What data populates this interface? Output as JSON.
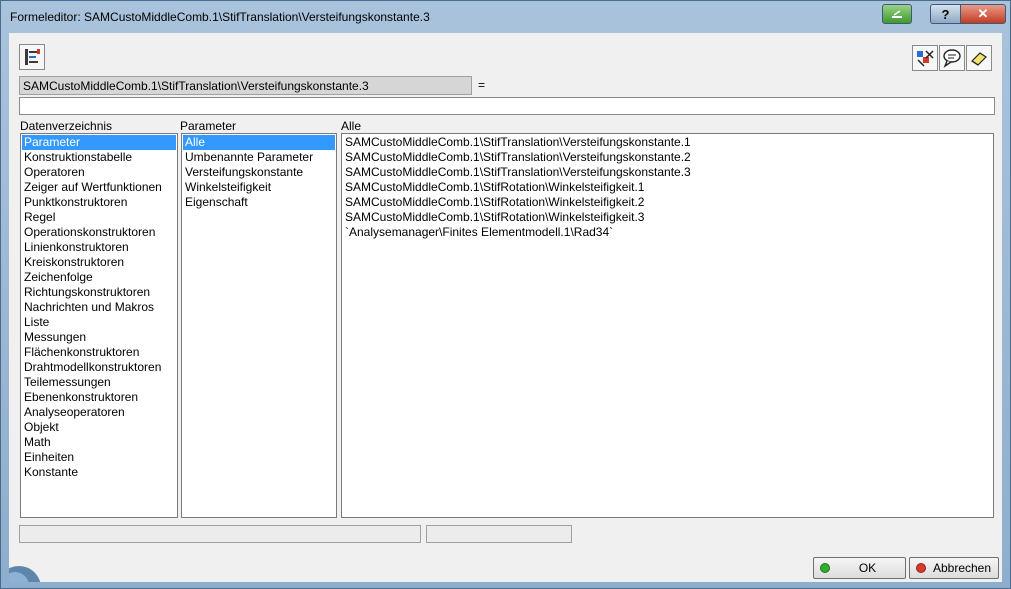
{
  "window": {
    "title": "Formeleditor: SAMCustoMiddleComb.1\\StifTranslation\\Versteifungskonstante.3"
  },
  "formula": {
    "parameter_path": "SAMCustoMiddleComb.1\\StifTranslation\\Versteifungskonstante.3",
    "equals": "=",
    "value": ""
  },
  "columns": {
    "dictionary": {
      "header": "Datenverzeichnis",
      "selected_index": 0,
      "items": [
        "Parameter",
        "Konstruktionstabelle",
        "Operatoren",
        "Zeiger auf Wertfunktionen",
        "Punktkonstruktoren",
        "Regel",
        "Operationskonstruktoren",
        "Linienkonstruktoren",
        "Kreiskonstruktoren",
        "Zeichenfolge",
        "Richtungskonstruktoren",
        "Nachrichten und Makros",
        "Liste",
        "Messungen",
        "Flächenkonstruktoren",
        "Drahtmodellkonstruktoren",
        "Teilemessungen",
        "Ebenenkonstruktoren",
        "Analyseoperatoren",
        "Objekt",
        "Math",
        "Einheiten",
        "Konstante"
      ]
    },
    "parameter": {
      "header": "Parameter",
      "selected_index": 0,
      "items": [
        "Alle",
        "Umbenannte Parameter",
        "Versteifungskonstante",
        "Winkelsteifigkeit",
        "Eigenschaft"
      ]
    },
    "members": {
      "header": "Alle",
      "items": [
        "SAMCustoMiddleComb.1\\StifTranslation\\Versteifungskonstante.1",
        "SAMCustoMiddleComb.1\\StifTranslation\\Versteifungskonstante.2",
        "SAMCustoMiddleComb.1\\StifTranslation\\Versteifungskonstante.3",
        "SAMCustoMiddleComb.1\\StifRotation\\Winkelsteifigkeit.1",
        "SAMCustoMiddleComb.1\\StifRotation\\Winkelsteifigkeit.2",
        "SAMCustoMiddleComb.1\\StifRotation\\Winkelsteifigkeit.3",
        "`Analysemanager\\Finites Elementmodell.1\\Rad34`"
      ]
    }
  },
  "buttons": {
    "ok_label": "OK",
    "cancel_label": "Abbrechen"
  },
  "colors": {
    "selection": "#3399ff",
    "ok_dot": "#2fae2f",
    "cancel_dot": "#d83a2a"
  },
  "icons": {
    "caption_minimize": "minimize-icon",
    "caption_help": "help-icon",
    "caption_close": "close-icon",
    "toolbar_left": "formula-tree-icon",
    "toolbar_right": [
      "parameter-select-icon",
      "comment-bubble-icon",
      "eraser-icon"
    ]
  }
}
